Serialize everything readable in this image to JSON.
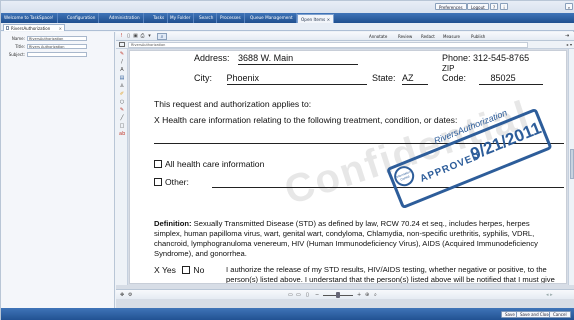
{
  "utility": {
    "preferences": "Preferences",
    "logout": "Logout",
    "help": "?",
    "close": "x"
  },
  "nav": {
    "items": [
      "Welcome to TaskSpace!",
      "Configuration",
      "Administration",
      "Tasks",
      "My Folder",
      "Search",
      "Processes",
      "Queue Management",
      "Open Items"
    ],
    "active_close": "×"
  },
  "doc_tab": {
    "label": "RiversAuthorization",
    "close": "×"
  },
  "form": {
    "name_label": "Name:",
    "name_value": "RiversAuthorization",
    "title_label": "Title:",
    "title_value": "Rivers Authorization",
    "subject_label": "Subject:",
    "subject_value": ""
  },
  "viewer": {
    "menus": [
      "Annotate",
      "Review",
      "Redact",
      "Measure",
      "Publish"
    ],
    "breadcrumb": "RiversAuthorization",
    "tools": [
      "A",
      "A",
      "A",
      "A",
      "A",
      "A",
      "A",
      "A",
      "A",
      "A",
      "A",
      "A"
    ]
  },
  "document": {
    "address_label": "Address:",
    "address_value": "3688 W. Main",
    "phone": "Phone: 312-545-8765",
    "city_label": "City:",
    "city_value": "Phoenix",
    "state_label": "State:",
    "state_value": "AZ",
    "zip_label": "ZIP",
    "zip_code_label": "Code:",
    "zip_value": "85025",
    "request_intro": "This request and authorization applies to:",
    "health_info": "X Health care information relating to the following treatment, condition, or dates:",
    "all_info": "All health care information",
    "other": "Other:",
    "definition_label": "Definition:",
    "definition_text": " Sexually Transmitted Disease (STD) as defined by law, RCW 70.24 et seq., includes herpes, herpes simplex, human papilloma virus, wart, genital wart, condyloma, Chlamydia, non-specific urethritis, syphilis, VDRL, chancroid, lymphogranuloma venereum, HIV (Human Immunodeficiency Virus), AIDS (Acquired Immunodeficiency Syndrome), and gonorrhea.",
    "x_yes": "X Yes",
    "no": "No",
    "authorize_text": "I authorize the release of my STD results, HIV/AIDS testing, whether negative or positive, to the person(s) listed above. I understand that the person(s) listed above will be notified that I must give specific written permission before disclosure of these",
    "watermark": "Confidential",
    "stamp_top": "RiversAuthorization",
    "stamp_approved": "APPROVED",
    "stamp_date": "9/21/2011",
    "stamp_circle_1": "Information",
    "stamp_circle_2": "Copied"
  },
  "footer": {
    "save": "Save",
    "save_close": "Save and Close",
    "cancel": "Cancel"
  },
  "colors": {
    "nav": "#2a5ea3",
    "stamp": "#2d5d9a",
    "panel": "#eef2f7"
  }
}
